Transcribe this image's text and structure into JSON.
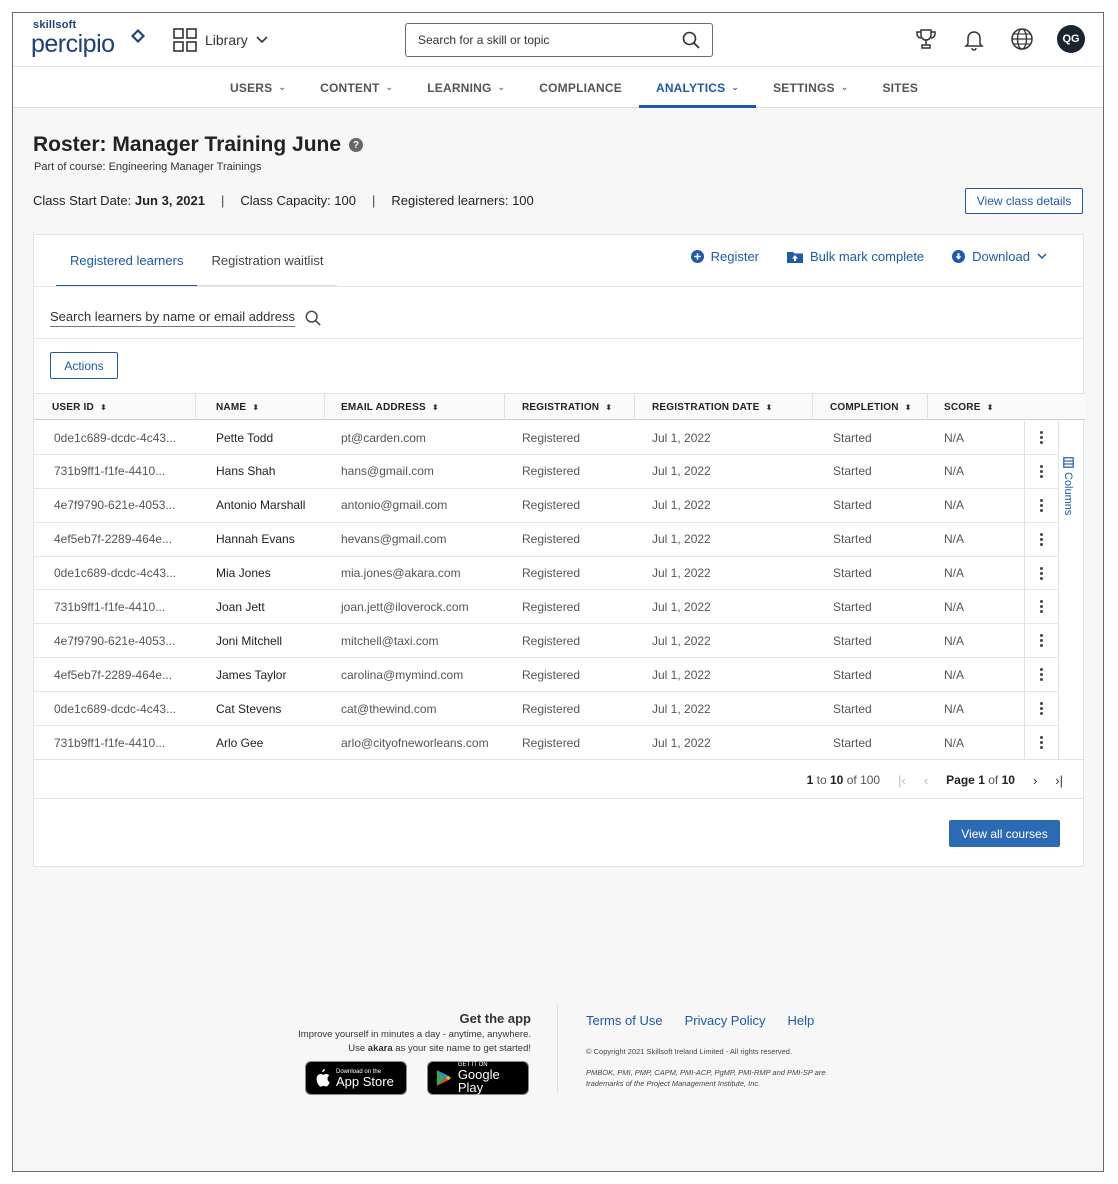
{
  "header": {
    "logo_small": "skillsoft",
    "logo_big": "percipio",
    "library_label": "Library",
    "search_placeholder": "Search for a skill or topic",
    "avatar_initials": "QG"
  },
  "nav": [
    {
      "label": "USERS",
      "has_menu": true
    },
    {
      "label": "CONTENT",
      "has_menu": true
    },
    {
      "label": "LEARNING",
      "has_menu": true
    },
    {
      "label": "COMPLIANCE",
      "has_menu": false
    },
    {
      "label": "ANALYTICS",
      "has_menu": true,
      "active": true
    },
    {
      "label": "SETTINGS",
      "has_menu": true
    },
    {
      "label": "SITES",
      "has_menu": false
    }
  ],
  "page": {
    "title": "Roster: Manager Training June",
    "course_line": "Part of course:  Engineering Manager Trainings",
    "start_label": "Class Start Date:",
    "start_value": "Jun 3, 2021",
    "capacity": "Class Capacity: 100",
    "registered": "Registered learners: 100",
    "view_details": "View class details"
  },
  "card": {
    "tabs": [
      "Registered learners",
      "Registration waitlist"
    ],
    "actions": {
      "register": "Register",
      "bulk": "Bulk mark complete",
      "download": "Download"
    },
    "search_text": "Search learners by name or email address",
    "actions_button": "Actions",
    "columns_label": "Columns",
    "view_all": "View all courses"
  },
  "table": {
    "headers": [
      "USER ID",
      "NAME",
      "EMAIL ADDRESS",
      "REGISTRATION",
      "REGISTRATION DATE",
      "COMPLETION",
      "SCORE"
    ],
    "rows": [
      [
        "0de1c689-dcdc-4c43...",
        "Pette Todd",
        "pt@carden.com",
        "Registered",
        "Jul 1, 2022",
        "Started",
        "N/A"
      ],
      [
        "731b9ff1-f1fe-4410...",
        "Hans Shah",
        "hans@gmail.com",
        "Registered",
        "Jul 1, 2022",
        "Started",
        "N/A"
      ],
      [
        "4e7f9790-621e-4053...",
        "Antonio Marshall",
        "antonio@gmail.com",
        "Registered",
        "Jul 1, 2022",
        "Started",
        "N/A"
      ],
      [
        "4ef5eb7f-2289-464e...",
        "Hannah Evans",
        "hevans@gmail.com",
        "Registered",
        "Jul 1, 2022",
        "Started",
        "N/A"
      ],
      [
        "0de1c689-dcdc-4c43...",
        "Mia Jones",
        "mia.jones@akara.com",
        "Registered",
        "Jul 1, 2022",
        "Started",
        "N/A"
      ],
      [
        "731b9ff1-f1fe-4410...",
        "Joan Jett",
        "joan.jett@iloverock.com",
        "Registered",
        "Jul 1, 2022",
        "Started",
        "N/A"
      ],
      [
        "4e7f9790-621e-4053...",
        "Joni Mitchell",
        "mitchell@taxi.com",
        "Registered",
        "Jul 1, 2022",
        "Started",
        "N/A"
      ],
      [
        "4ef5eb7f-2289-464e...",
        "James Taylor",
        "carolina@mymind.com",
        "Registered",
        "Jul 1, 2022",
        "Started",
        "N/A"
      ],
      [
        "0de1c689-dcdc-4c43...",
        "Cat Stevens",
        "cat@thewind.com",
        "Registered",
        "Jul 1, 2022",
        "Started",
        "N/A"
      ],
      [
        "731b9ff1-f1fe-4410...",
        "Arlo Gee",
        "arlo@cityofneworleans.com",
        "Registered",
        "Jul 1, 2022",
        "Started",
        "N/A"
      ]
    ]
  },
  "pager": {
    "range_from": "1",
    "range_to": "10",
    "total": "100",
    "page_label": "Page",
    "page": "1",
    "of": "of",
    "pages": "10",
    "to_word": "to"
  },
  "footer": {
    "app_title": "Get the app",
    "app_line1": "Improve yourself in minutes a day - anytime, anywhere.",
    "app_line2_pre": "Use ",
    "app_line2_bold": "akara",
    "app_line2_post": " as your site name to get started!",
    "appstore_small": "Download on the",
    "appstore_big": "App Store",
    "gplay_small": "GET IT ON",
    "gplay_big": "Google Play",
    "links": [
      "Terms of Use",
      "Privacy Policy",
      "Help"
    ],
    "copyright": "© Copyright 2021 Skillsoft Ireland Limited - All rights reserved.",
    "trademark": "PMBOK, PMI, PMP, CAPM, PMI-ACP, PgMP, PMI-RMP and PMI-SP are trademarks of the Project Management Institute, Inc."
  },
  "colors": {
    "accent": "#1e5aa8",
    "primary_button": "#2d6ab4",
    "avatar_bg": "#1b2431"
  }
}
